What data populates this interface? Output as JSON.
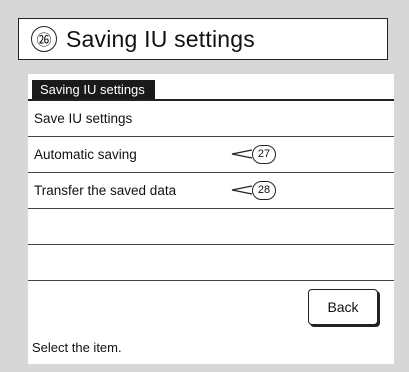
{
  "header": {
    "callout_number": "㉖",
    "title": "Saving IU settings"
  },
  "panel": {
    "tab_label": "Saving IU settings",
    "rows": [
      {
        "label": "Save IU settings",
        "callout": ""
      },
      {
        "label": "Automatic saving",
        "callout": "27"
      },
      {
        "label": "Transfer the saved data",
        "callout": "28"
      },
      {
        "label": "",
        "callout": ""
      },
      {
        "label": "",
        "callout": ""
      }
    ],
    "back_label": "Back",
    "status": "Select the item."
  }
}
